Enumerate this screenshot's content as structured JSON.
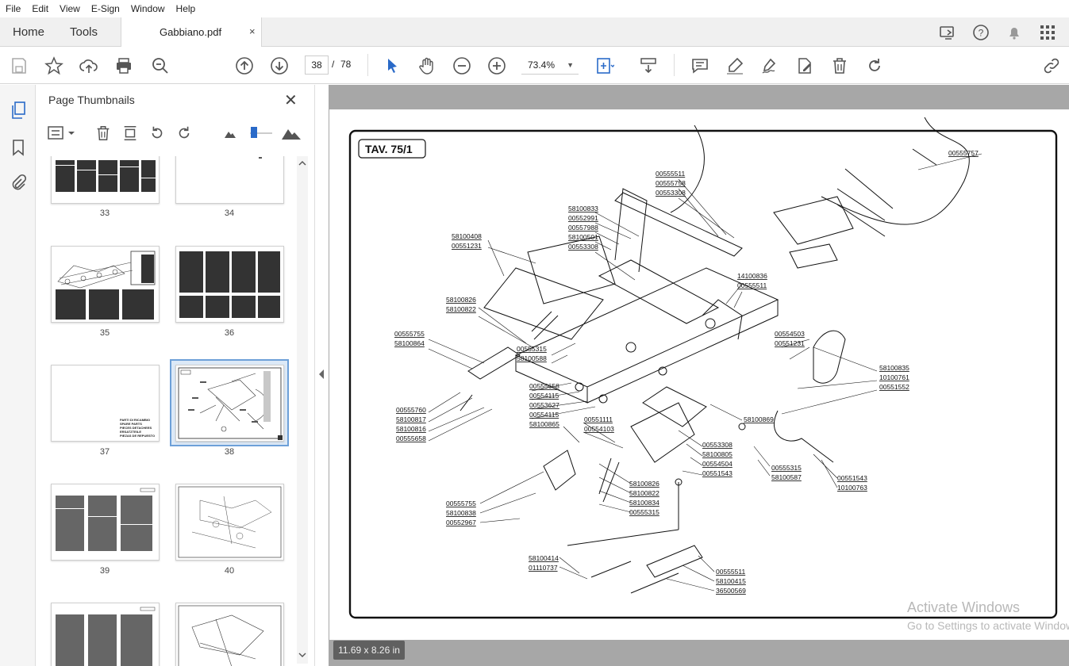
{
  "menu": [
    "File",
    "Edit",
    "View",
    "E-Sign",
    "Window",
    "Help"
  ],
  "tabs": {
    "home": "Home",
    "tools": "Tools",
    "doc_title": "Gabbiano.pdf",
    "close": "×"
  },
  "toolbar": {
    "current_page": "38",
    "page_sep": "/",
    "total_pages": "78",
    "zoom": "73.4%",
    "zoom_caret": "▼"
  },
  "panel": {
    "title": "Page Thumbnails",
    "close": "✕",
    "thumbnails": [
      {
        "num": "33"
      },
      {
        "num": "34"
      },
      {
        "num": "35"
      },
      {
        "num": "36"
      },
      {
        "num": "37"
      },
      {
        "num": "38"
      },
      {
        "num": "39"
      },
      {
        "num": "40"
      }
    ],
    "page37_lines": [
      "PARTI DI RICAMBIO",
      "SPARE PARTS",
      "PIECES DETACHEES",
      "ERSATZTEILE",
      "PIEZAS DE REPUESTO"
    ],
    "selected_page": "38"
  },
  "document": {
    "plate_title": "TAV. 75/1",
    "size_badge": "11.69 x 8.26 in",
    "labels": {
      "l00555757": "00555757",
      "l00555511a": "00555511",
      "l00555758": "00555758",
      "l00553308a": "00553308",
      "l58100833": "58100833",
      "l00552991": "00552991",
      "l00557988": "00557988",
      "l58100501": "58100501",
      "l00553308b": "00553308",
      "l58100408": "58100408",
      "l00551231a": "00551231",
      "l14100836": "14100836",
      "l00555511b": "00555511",
      "l58100826a": "58100826",
      "l58100822a": "58100822",
      "l00555755a": "00555755",
      "l58100864": "58100864",
      "l00555315a": "00555315",
      "l58100588": "58100588",
      "l00554503": "00554503",
      "l00551231b": "00551231",
      "l58100835": "58100835",
      "l10100761": "10100761",
      "l00551552": "00551552",
      "l00555658a": "00555658",
      "l00554115a": "00554115",
      "l00553627": "00553627",
      "l00554115b": "00554115",
      "l00555760": "00555760",
      "l58100817": "58100817",
      "l58100816": "58100816",
      "l00555658b": "00555658",
      "l00551111": "00551111",
      "l58100865": "58100865",
      "l00554103": "00554103",
      "l58100869": "58100869",
      "l00553308c": "00553308",
      "l58100805": "58100805",
      "l00554504": "00554504",
      "l00551543a": "00551543",
      "l00555315b": "00555315",
      "l58100587": "58100587",
      "l00551543b": "00551543",
      "l10100763": "10100763",
      "l58100826b": "58100826",
      "l58100822b": "58100822",
      "l58100834": "58100834",
      "l00555315c": "00555315",
      "l00555755b": "00555755",
      "l58100838": "58100838",
      "l00552967": "00552967",
      "l58100414": "58100414",
      "l01110737": "01110737",
      "l00555511c": "00555511",
      "l58100415": "58100415",
      "l36500569": "36500569"
    }
  },
  "watermark": {
    "line1": "Activate Windows",
    "line2": "Go to Settings to activate Windows."
  }
}
